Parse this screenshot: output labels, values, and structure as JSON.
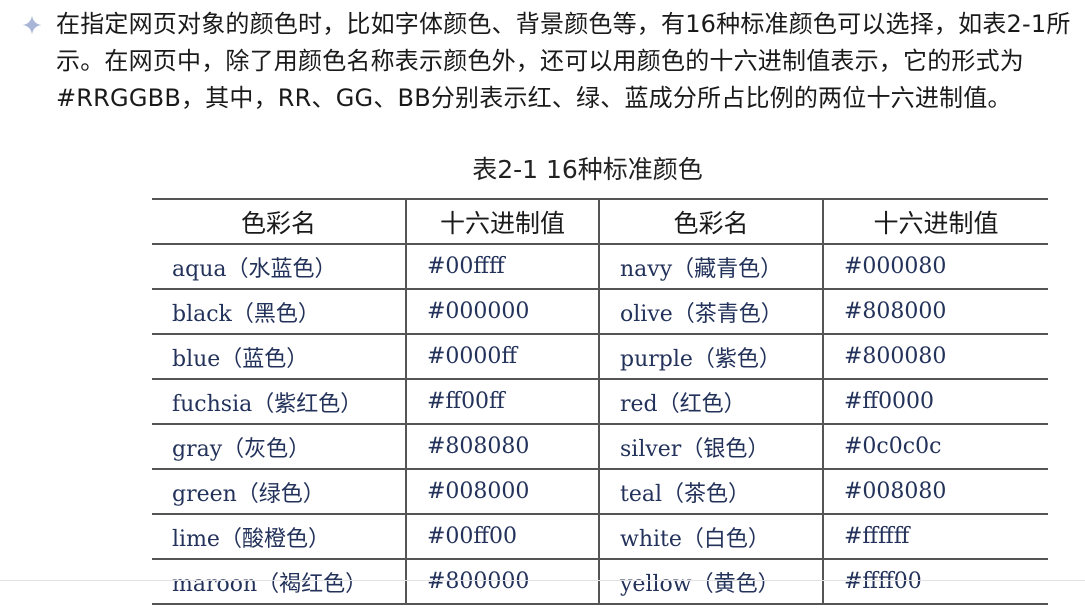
{
  "paragraph": "在指定网页对象的颜色时，比如字体颜色、背景颜色等，有16种标准颜色可以选择，如表2-1所示。在网页中，除了用颜色名称表示颜色外，还可以用颜色的十六进制值表示，它的形式为#RRGGBB，其中，RR、GG、BB分别表示红、绿、蓝成分所占比例的两位十六进制值。",
  "table": {
    "caption": "表2-1 16种标准颜色",
    "headers": [
      "色彩名",
      "十六进制值",
      "色彩名",
      "十六进制值"
    ],
    "rows": [
      [
        "aqua（水蓝色）",
        "#00ffff",
        "navy（藏青色）",
        "#000080"
      ],
      [
        "black（黑色）",
        "#000000",
        "olive（茶青色）",
        "#808000"
      ],
      [
        "blue（蓝色）",
        "#0000ff",
        "purple（紫色）",
        "#800080"
      ],
      [
        "fuchsia（紫红色）",
        "#ff00ff",
        "red（红色）",
        "#ff0000"
      ],
      [
        "gray（灰色）",
        "#808080",
        "silver（银色）",
        "#0c0c0c"
      ],
      [
        "green（绿色）",
        "#008000",
        "teal（茶色）",
        "#008080"
      ],
      [
        "lime（酸橙色）",
        "#00ff00",
        "white（白色）",
        "#ffffff"
      ],
      [
        "maroon（褐红色）",
        "#800000",
        "yellow（黄色）",
        "#ffff00"
      ]
    ]
  },
  "icons": {
    "bullet": "diamond-bullet-icon"
  },
  "colors": {
    "bullet": "#a9b6d8",
    "body_text": "#1a1a1a",
    "cell_text": "#23325a",
    "rule": "#555555"
  }
}
